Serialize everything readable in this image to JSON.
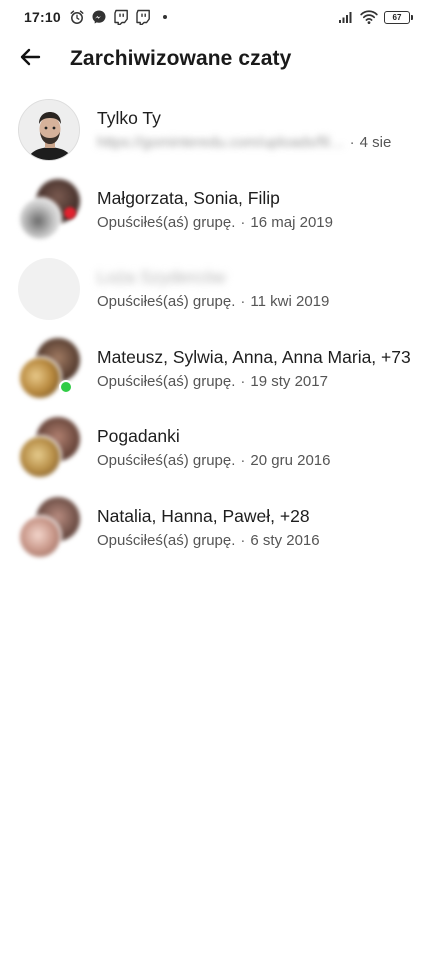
{
  "status_bar": {
    "time": "17:10",
    "battery_level": "67",
    "icons_left": [
      "alarm-icon",
      "messenger-icon",
      "twitch-icon",
      "twitch-icon"
    ],
    "icons_right": [
      "signal-icon",
      "wifi-icon",
      "battery-icon"
    ]
  },
  "header": {
    "title": "Zarchiwizowane czaty",
    "back_icon": "arrow-left-icon"
  },
  "chats": [
    {
      "name": "Tylko Ty",
      "preview": "https://gominteredu.com/uploads/fil…",
      "preview_blurred": true,
      "date": "4 sie",
      "avatar_type": "single-photo"
    },
    {
      "name": "Małgorzata, Sonia, Filip",
      "preview": "Opuściłeś(aś) grupę.",
      "date": "16 maj 2019",
      "avatar_type": "group"
    },
    {
      "name": "Loża Szyderców",
      "name_blurred": true,
      "preview": "Opuściłeś(aś) grupę.",
      "date": "11 kwi 2019",
      "avatar_type": "placeholder"
    },
    {
      "name": "Mateusz, Sylwia, Anna, Anna Maria, +73",
      "preview": "Opuściłeś(aś) grupę.",
      "date": "19 sty 2017",
      "avatar_type": "group",
      "online": true
    },
    {
      "name": "Pogadanki",
      "preview": "Opuściłeś(aś) grupę.",
      "date": "20 gru 2016",
      "avatar_type": "group"
    },
    {
      "name": "Natalia, Hanna, Paweł, +28",
      "preview": "Opuściłeś(aś) grupę.",
      "date": "6 sty 2016",
      "avatar_type": "group"
    }
  ],
  "separator": "·",
  "colors": {
    "online": "#31cc46",
    "text_primary": "#1e1e1e",
    "text_secondary": "#555555",
    "background": "#ffffff"
  }
}
